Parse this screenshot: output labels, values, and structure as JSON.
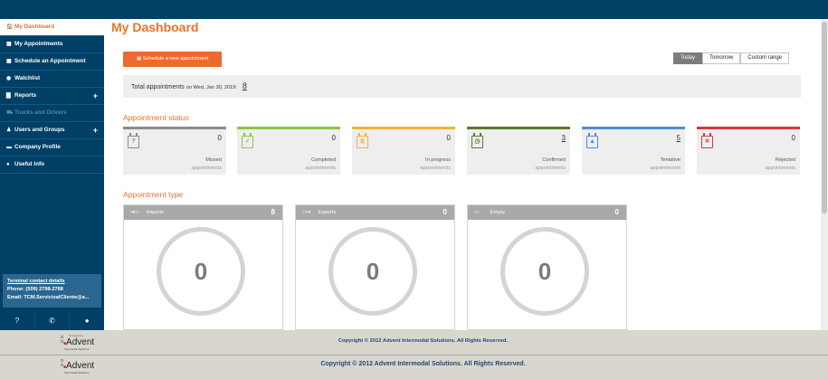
{
  "sidebar": {
    "items": [
      {
        "label": "My Dashboard",
        "icon": "home-icon",
        "glyph": "🏠"
      },
      {
        "label": "My Appointments",
        "icon": "calendar-icon",
        "glyph": "▦"
      },
      {
        "label": "Schedule an Appointment",
        "icon": "calendar-plus-icon",
        "glyph": "▦"
      },
      {
        "label": "Watchlist",
        "icon": "eye-icon",
        "glyph": "◉"
      },
      {
        "label": "Reports",
        "icon": "book-icon",
        "glyph": "▇"
      },
      {
        "label": "Trucks and Drivers",
        "icon": "truck-icon",
        "glyph": "⛟"
      },
      {
        "label": "Users and Groups",
        "icon": "users-icon",
        "glyph": "♟"
      },
      {
        "label": "Company Profile",
        "icon": "building-icon",
        "glyph": "▬"
      },
      {
        "label": "Useful Info",
        "icon": "info-icon",
        "glyph": "●"
      }
    ],
    "contact": {
      "title": "Terminal contact details",
      "phone_label": "Phone:",
      "phone": "(509) 2798-2788",
      "email_label": "Email:",
      "email": "TCM.ServicioalCliente@a..."
    },
    "footer_icons": [
      {
        "icon": "help-icon",
        "glyph": "?"
      },
      {
        "icon": "phone-icon",
        "glyph": "✆"
      },
      {
        "icon": "chat-icon",
        "glyph": "●"
      }
    ]
  },
  "main": {
    "title": "My Dashboard",
    "schedule_button": "Schedule a new appointment",
    "range_tabs": [
      "Today",
      "Tomorrow",
      "Custom range"
    ],
    "selected_range": "Today",
    "total": {
      "label": "Total appointments",
      "date": "on Wed, Jan 30, 2019:",
      "count": "8"
    },
    "status_title": "Appointment status",
    "status_cards": [
      {
        "label": "Missed",
        "sub": "appointments",
        "count": "0",
        "color": "#8c8c8c",
        "icon": "question-calendar-icon",
        "glyph": "?",
        "underline": false
      },
      {
        "label": "Completed",
        "sub": "appointments",
        "count": "0",
        "color": "#8dc63f",
        "icon": "check-calendar-icon",
        "glyph": "✓",
        "underline": false
      },
      {
        "label": "In progress",
        "sub": "appointments",
        "count": "0",
        "color": "#f3b23c",
        "icon": "hourglass-calendar-icon",
        "glyph": "⧗",
        "underline": false
      },
      {
        "label": "Confirmed",
        "sub": "appointments",
        "count": "3",
        "color": "#5a7b2f",
        "icon": "clock-calendar-icon",
        "glyph": "◷",
        "underline": true
      },
      {
        "label": "Tentative",
        "sub": "appointments",
        "count": "5",
        "color": "#4a8fd8",
        "icon": "warning-calendar-icon",
        "glyph": "▲",
        "underline": true
      },
      {
        "label": "Rejected",
        "sub": "appointments",
        "count": "0",
        "color": "#d9363e",
        "icon": "x-calendar-icon",
        "glyph": "✕",
        "underline": false
      }
    ],
    "type_title": "Appointment type",
    "type_cards": [
      {
        "label": "Imports",
        "count": "8",
        "value": "0",
        "icon": "import-container-icon",
        "glyph": "➜▭"
      },
      {
        "label": "Exports",
        "count": "0",
        "value": "0",
        "icon": "export-container-icon",
        "glyph": "▭➜"
      },
      {
        "label": "Empty",
        "count": "0",
        "value": "0",
        "icon": "empty-container-icon",
        "glyph": "▭"
      }
    ]
  },
  "footer": {
    "copyright": "Copyright © 2012 Advent Intermodal Solutions. All Rights Reserved.",
    "logo_text": "Advent",
    "logo_sub": "Intermodal Solutions",
    "logo_powered": "Powered by"
  }
}
